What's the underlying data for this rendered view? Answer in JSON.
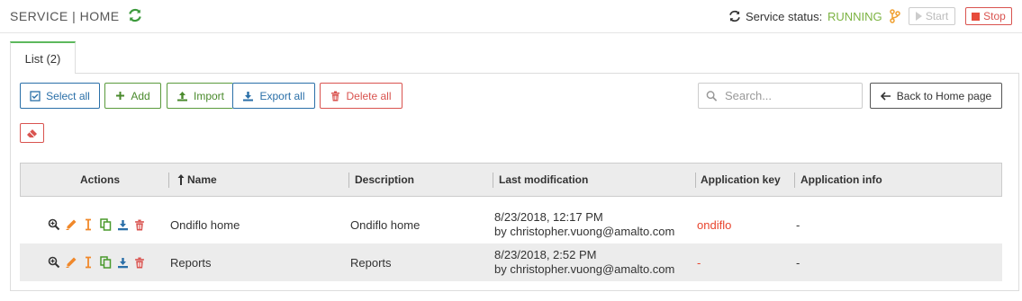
{
  "header": {
    "title": "SERVICE | HOME",
    "status_label": "Service status:",
    "status_value": "RUNNING",
    "start_label": "Start",
    "stop_label": "Stop"
  },
  "tabs": [
    {
      "label": "List (2)"
    }
  ],
  "toolbar": {
    "select_all": "Select all",
    "add": "Add",
    "import": "Import",
    "export_all": "Export all",
    "delete_all": "Delete all",
    "search_placeholder": "Search...",
    "back_home": "Back to Home page"
  },
  "table": {
    "columns": [
      "Actions",
      "Name",
      "Description",
      "Last modification",
      "Application key",
      "Application info"
    ],
    "rows": [
      {
        "name": "Ondiflo home",
        "description": "Ondiflo home",
        "modified_date": "8/23/2018, 12:17 PM",
        "modified_by": "by christopher.vuong@amalto.com",
        "app_key": "ondiflo",
        "app_info": "-"
      },
      {
        "name": "Reports",
        "description": "Reports",
        "modified_date": "8/23/2018, 2:52 PM",
        "modified_by": "by christopher.vuong@amalto.com",
        "app_key": "-",
        "app_info": "-"
      }
    ]
  },
  "colors": {
    "running": "#7cb342",
    "primary_blue": "#2a6fa8",
    "success_green": "#5a9a3c",
    "danger_red": "#d9534f",
    "app_key": "#e8442d"
  },
  "icons": [
    "refresh-icon",
    "branch-icon",
    "play-icon",
    "stop-icon",
    "check-square-icon",
    "plus-icon",
    "upload-icon",
    "download-icon",
    "trash-icon",
    "search-icon",
    "arrow-left-icon",
    "eraser-icon",
    "sort-up-icon",
    "zoom-in-icon",
    "pencil-icon",
    "text-cursor-icon",
    "copy-icon"
  ]
}
